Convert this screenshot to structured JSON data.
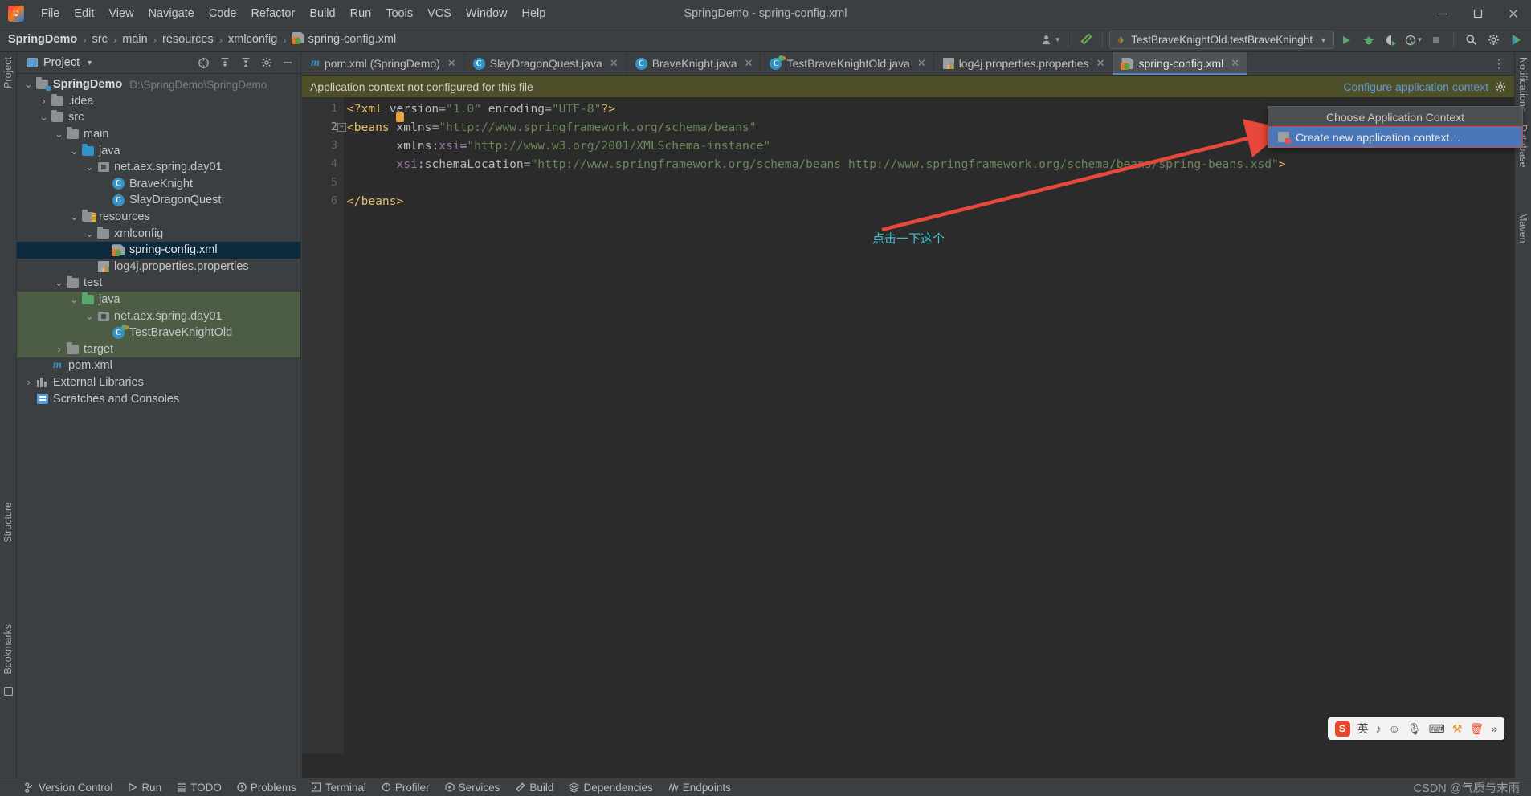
{
  "window": {
    "title": "SpringDemo - spring-config.xml",
    "minimize_label": "─",
    "maximize_label": "☐",
    "close_label": "✕"
  },
  "menubar": {
    "items": [
      {
        "label": "File",
        "mnemonic": "F"
      },
      {
        "label": "Edit",
        "mnemonic": "E"
      },
      {
        "label": "View",
        "mnemonic": "V"
      },
      {
        "label": "Navigate",
        "mnemonic": "N"
      },
      {
        "label": "Code",
        "mnemonic": "C"
      },
      {
        "label": "Refactor",
        "mnemonic": "R"
      },
      {
        "label": "Build",
        "mnemonic": "B"
      },
      {
        "label": "Run",
        "mnemonic": "u"
      },
      {
        "label": "Tools",
        "mnemonic": "T"
      },
      {
        "label": "VCS",
        "mnemonic": "S"
      },
      {
        "label": "Window",
        "mnemonic": "W"
      },
      {
        "label": "Help",
        "mnemonic": "H"
      }
    ]
  },
  "breadcrumb": {
    "items": [
      "SpringDemo",
      "src",
      "main",
      "resources",
      "xmlconfig",
      "spring-config.xml"
    ],
    "separator": "›"
  },
  "toolbar": {
    "run_config": "TestBraveKnightOld.testBraveKninght",
    "run_title": "Run",
    "debug_title": "Debug",
    "coverage_title": "Run with Coverage",
    "profiler_title": "Profiler",
    "stop_title": "Stop",
    "search_title": "Search Everywhere",
    "settings_title": "Settings",
    "account_title": "Account",
    "updates_title": "Updates"
  },
  "project_panel": {
    "title": "Project",
    "tree": [
      {
        "label": "SpringDemo",
        "sub": "D:\\SpringDemo\\SpringDemo",
        "depth": 0,
        "arrow": "v",
        "icon": "module-folder",
        "bold": true
      },
      {
        "label": ".idea",
        "sub": "",
        "depth": 1,
        "arrow": ">",
        "icon": "folder-gray"
      },
      {
        "label": "src",
        "sub": "",
        "depth": 1,
        "arrow": "v",
        "icon": "folder-gray"
      },
      {
        "label": "main",
        "sub": "",
        "depth": 2,
        "arrow": "v",
        "icon": "folder-gray"
      },
      {
        "label": "java",
        "sub": "",
        "depth": 3,
        "arrow": "v",
        "icon": "folder-blue"
      },
      {
        "label": "net.aex.spring.day01",
        "sub": "",
        "depth": 4,
        "arrow": "v",
        "icon": "package"
      },
      {
        "label": "BraveKnight",
        "sub": "",
        "depth": 5,
        "arrow": "",
        "icon": "class"
      },
      {
        "label": "SlayDragonQuest",
        "sub": "",
        "depth": 5,
        "arrow": "",
        "icon": "class"
      },
      {
        "label": "resources",
        "sub": "",
        "depth": 3,
        "arrow": "v",
        "icon": "folder-resources"
      },
      {
        "label": "xmlconfig",
        "sub": "",
        "depth": 4,
        "arrow": "v",
        "icon": "folder-gray"
      },
      {
        "label": "spring-config.xml",
        "sub": "",
        "depth": 5,
        "arrow": "",
        "icon": "xml-spring",
        "selected": true
      },
      {
        "label": "log4j.properties.properties",
        "sub": "",
        "depth": 4,
        "arrow": "",
        "icon": "properties"
      },
      {
        "label": "test",
        "sub": "",
        "depth": 2,
        "arrow": "v",
        "icon": "folder-gray"
      },
      {
        "label": "java",
        "sub": "",
        "depth": 3,
        "arrow": "v",
        "icon": "folder-green",
        "testbg": true
      },
      {
        "label": "net.aex.spring.day01",
        "sub": "",
        "depth": 4,
        "arrow": "v",
        "icon": "package",
        "testbg": true
      },
      {
        "label": "TestBraveKnightOld",
        "sub": "",
        "depth": 5,
        "arrow": "",
        "icon": "class-test",
        "testbg": true
      },
      {
        "label": "target",
        "sub": "",
        "depth": 2,
        "arrow": ">",
        "icon": "folder-gray",
        "testbg": true
      },
      {
        "label": "pom.xml",
        "sub": "",
        "depth": 1,
        "arrow": "",
        "icon": "maven"
      },
      {
        "label": "External Libraries",
        "sub": "",
        "depth": 0,
        "arrow": ">",
        "icon": "library"
      },
      {
        "label": "Scratches and Consoles",
        "sub": "",
        "depth": 0,
        "arrow": "",
        "icon": "scratches"
      }
    ]
  },
  "editor": {
    "tabs": [
      {
        "label": "pom.xml (SpringDemo)",
        "icon": "maven-icon",
        "active": false
      },
      {
        "label": "SlayDragonQuest.java",
        "icon": "class-icon",
        "active": false
      },
      {
        "label": "BraveKnight.java",
        "icon": "class-icon",
        "active": false
      },
      {
        "label": "TestBraveKnightOld.java",
        "icon": "class-test-icon",
        "active": false
      },
      {
        "label": "log4j.properties.properties",
        "icon": "properties-icon",
        "active": false
      },
      {
        "label": "spring-config.xml",
        "icon": "xml-spring-icon",
        "active": true
      }
    ],
    "notification": {
      "message": "Application context not configured for this file",
      "action_label": "Configure application context"
    },
    "lines": [
      {
        "num": "1",
        "tokens": [
          {
            "t": "<?xml ",
            "c": "tagc"
          },
          {
            "t": "version",
            "c": "attr"
          },
          {
            "t": "=",
            "c": "punct"
          },
          {
            "t": "\"1.0\"",
            "c": "val"
          },
          {
            "t": " ",
            "c": "punct"
          },
          {
            "t": "encoding",
            "c": "attr"
          },
          {
            "t": "=",
            "c": "punct"
          },
          {
            "t": "\"UTF-8\"",
            "c": "val"
          },
          {
            "t": "?>",
            "c": "tagc"
          }
        ]
      },
      {
        "num": "2",
        "fold": true,
        "tokens": [
          {
            "t": "<beans ",
            "c": "tagc"
          },
          {
            "t": "xmlns",
            "c": "attr"
          },
          {
            "t": "=",
            "c": "punct"
          },
          {
            "t": "\"http://www.springframework.org/schema/beans\"",
            "c": "val"
          }
        ]
      },
      {
        "num": "3",
        "tokens": [
          {
            "t": "       xmlns",
            "c": "attr"
          },
          {
            "t": ":",
            "c": "punct"
          },
          {
            "t": "xsi",
            "c": "attr2"
          },
          {
            "t": "=",
            "c": "punct"
          },
          {
            "t": "\"http://www.w3.org/2001/XMLSchema-instance\"",
            "c": "val"
          }
        ]
      },
      {
        "num": "4",
        "tokens": [
          {
            "t": "       xsi",
            "c": "attr2"
          },
          {
            "t": ":",
            "c": "punct"
          },
          {
            "t": "schemaLocation",
            "c": "attr"
          },
          {
            "t": "=",
            "c": "punct"
          },
          {
            "t": "\"http://www.springframework.org/schema/beans http://www.springframework.org/schema/beans/spring-beans.xsd\"",
            "c": "val"
          },
          {
            "t": ">",
            "c": "tagc"
          }
        ]
      },
      {
        "num": "5",
        "tokens": []
      },
      {
        "num": "6",
        "tokens": [
          {
            "t": "</beans>",
            "c": "tagc"
          }
        ]
      }
    ],
    "annotation_cn": "点击一下这个"
  },
  "popup": {
    "title": "Choose Application Context",
    "items": [
      {
        "label": "Create new application context…",
        "selected": true
      }
    ]
  },
  "ime": {
    "lang": "英",
    "items": [
      "♪",
      "☺",
      "🎙",
      "⌨",
      "✂",
      "🗑",
      "»"
    ]
  },
  "rails": {
    "left_top": "Project",
    "left_structure": "Structure",
    "left_bookmarks": "Bookmarks",
    "right_database": "Database",
    "right_maven": "Maven",
    "right_notifications": "Notifications"
  },
  "statusbar": {
    "items": [
      {
        "label": "Version Control",
        "icon": "branch-icon"
      },
      {
        "label": "Run",
        "icon": "play-icon"
      },
      {
        "label": "TODO",
        "icon": "list-icon"
      },
      {
        "label": "Problems",
        "icon": "warning-icon"
      },
      {
        "label": "Terminal",
        "icon": "terminal-icon"
      },
      {
        "label": "Profiler",
        "icon": "profiler-icon"
      },
      {
        "label": "Services",
        "icon": "services-icon"
      },
      {
        "label": "Build",
        "icon": "hammer-icon"
      },
      {
        "label": "Dependencies",
        "icon": "layers-icon"
      },
      {
        "label": "Endpoints",
        "icon": "endpoints-icon"
      }
    ]
  },
  "watermark": "CSDN @气质与末雨",
  "colors": {
    "accent": "#4a88c7",
    "notification_bg": "#4e4f29",
    "selection": "#0d293e",
    "test_scope": "#4d5c44",
    "popup_selected": "#4a77b8",
    "annotation_red": "#e8473b",
    "annotation_cyan": "#3fc2cf"
  }
}
